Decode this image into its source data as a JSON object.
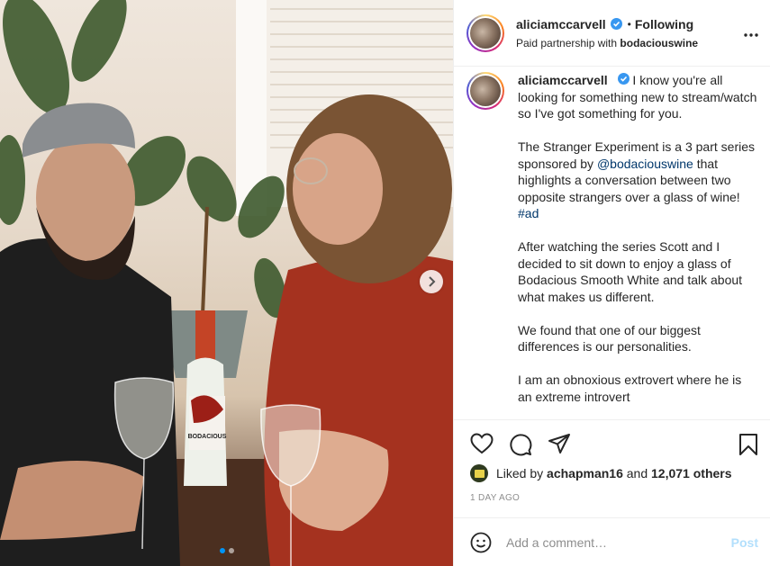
{
  "post": {
    "username": "aliciamccarvell",
    "following_label": "Following",
    "bullet": "•",
    "partnership_prefix": "Paid partnership with",
    "partner": "bodaciouswine"
  },
  "caption": {
    "username": "aliciamccarvell",
    "p1": "I know you're all looking for something new to stream/watch so I've got something for you.",
    "p2_a": "The Stranger Experiment is a 3 part series sponsored by",
    "p2_mention": "@bodaciouswine",
    "p2_b": "that highlights a conversation between two opposite strangers over a glass of wine!",
    "p2_hashtag": "#ad",
    "p3": "After watching the series Scott and I decided to sit down to enjoy a glass of Bodacious Smooth White and talk about what makes us different.",
    "p4": "We found that one of our biggest differences is our personalities.",
    "p5": "I am an obnoxious extrovert where he is an extreme introvert"
  },
  "likes": {
    "prefix": "Liked by",
    "user": "achapman16",
    "and": "and",
    "count": "12,071 others"
  },
  "timestamp": "1 DAY AGO",
  "comment": {
    "placeholder": "Add a comment…",
    "post_label": "Post"
  },
  "photo": {
    "bottle_label": "BODACIOUS",
    "carousel_total": 2,
    "carousel_active": 1
  },
  "colors": {
    "verified": "#3897f0",
    "link": "#00376b",
    "post_button": "#b2dffc",
    "carousel_active": "#0095f6"
  },
  "icons": [
    "heart-icon",
    "comment-icon",
    "share-icon",
    "bookmark-icon",
    "more-icon",
    "emoji-icon",
    "chevron-right-icon",
    "verified-icon"
  ]
}
